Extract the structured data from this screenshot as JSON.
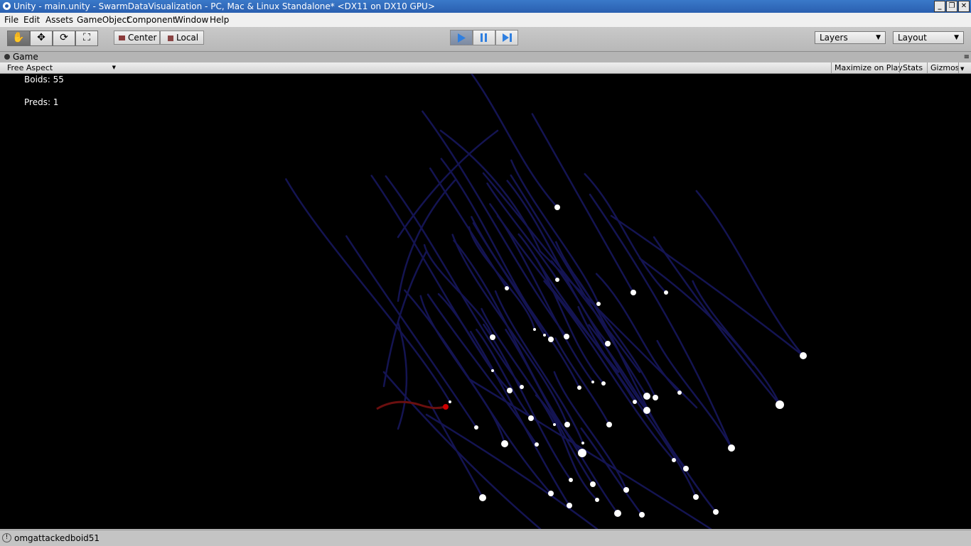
{
  "window": {
    "title": "Unity - main.unity - SwarmDataVisualization - PC, Mac & Linux Standalone* <DX11 on DX10 GPU>",
    "controls": [
      "minimize",
      "restore",
      "close"
    ]
  },
  "menu": [
    "File",
    "Edit",
    "Assets",
    "GameObject",
    "Component",
    "Window",
    "Help"
  ],
  "toolbar": {
    "tools": [
      "hand-icon",
      "move-icon",
      "rotate-icon",
      "scale-icon"
    ],
    "pivot_label": "Center",
    "space_label": "Local",
    "play_icons": [
      "play-icon",
      "pause-icon",
      "step-icon"
    ],
    "layers_label": "Layers",
    "layout_label": "Layout"
  },
  "game_tab": {
    "label": "Game",
    "aspect": "Free Aspect",
    "maximize_label": "Maximize on Play",
    "stats_label": "Stats",
    "gizmos_label": "Gizmos"
  },
  "hud": {
    "boids": "Boids: 55",
    "preds": "Preds: 1"
  },
  "status": {
    "message": "omgattackedboid51"
  },
  "colors": {
    "trail": "#141452",
    "boid": "#ffffff",
    "predator": "#cc0000",
    "predator_trail": "#6a0f0f",
    "background": "#000000"
  }
}
